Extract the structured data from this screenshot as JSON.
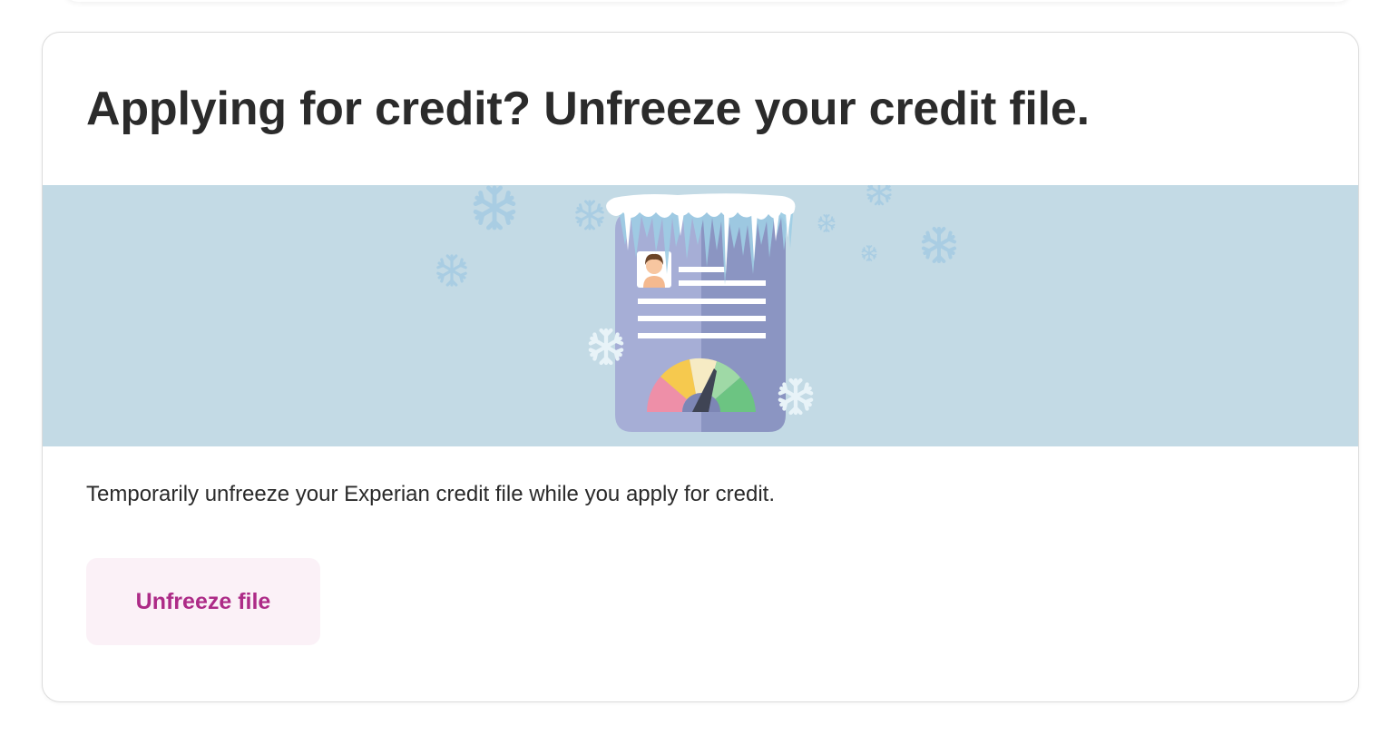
{
  "card": {
    "title": "Applying for credit? Unfreeze your credit file.",
    "description": "Temporarily unfreeze your Experian credit file while you apply for credit.",
    "button_label": "Unfreeze file"
  },
  "icons": {
    "illustration": "frozen-credit-report-illustration",
    "snowflake": "snowflake-icon",
    "gauge": "credit-score-gauge"
  },
  "colors": {
    "banner_background": "#c3dae5",
    "button_background": "#fbf1f7",
    "button_text": "#ad2b87",
    "title_text": "#2b2b2b",
    "report_left": "#a6aed6",
    "report_right": "#8b95c2",
    "gauge_red": "#ee8fa8",
    "gauge_yellow": "#f6c94e",
    "gauge_cream": "#f6ebc4",
    "gauge_light_green": "#9fd9a6",
    "gauge_green": "#6cc482"
  }
}
